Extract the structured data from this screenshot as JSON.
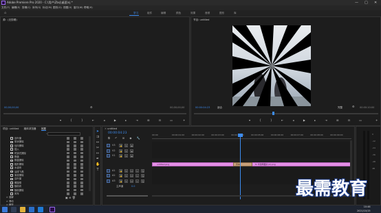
{
  "window": {
    "title": "Adobe Premiere Pro 2020 - C:\\用户\\Zbsj\\桌面\\nj *",
    "controls": [
      "—",
      "□",
      "✕"
    ]
  },
  "menu": [
    "文件(F)",
    "编辑(E)",
    "剪辑(C)",
    "序列(S)",
    "标记(M)",
    "图形(G)",
    "视图(V)",
    "窗口(W)",
    "帮助(H)"
  ],
  "workspaces": [
    "学习",
    "组件",
    "编辑",
    "颜色",
    "效果",
    "音频",
    "图形",
    "库"
  ],
  "workspace_active": "学习",
  "source_panel": {
    "tab": "源：(无剪辑)",
    "timecode_left": "00;00;00;00",
    "timecode_right": "00;00;00;00"
  },
  "program_panel": {
    "tab": "节目: untitled",
    "timecode": "00:00:04:23",
    "fit": "适合",
    "quality": "完整",
    "duration": "00:00:10:00"
  },
  "project_panel": {
    "tabs": [
      "项目: untitled",
      "媒体浏览器",
      "效果"
    ],
    "search_placeholder": "",
    "effects": [
      "百叶窗",
      "带状擦除",
      "径向擦除",
      "插入",
      "时钟式擦除",
      "棋盘",
      "棋盘擦除",
      "楔形擦除",
      "水波块",
      "油漆飞溅",
      "渐变擦除",
      "百叶窗",
      "螺旋框",
      "随机块",
      "随机擦除",
      "风车"
    ],
    "folders": [
      "> 溶解",
      "> 滑动",
      "> 缩放",
      "> 页面剥落"
    ],
    "footer_icons": [
      "list-view-icon",
      "icon-view-icon",
      "freeform-icon",
      "sort-icon",
      "search-icon",
      "folder-icon",
      "new-item-icon",
      "clear-icon"
    ]
  },
  "timeline": {
    "tab": "untitled",
    "timecode": "00:00:04:23",
    "ruler": [
      "00:00",
      "00:00:01:00",
      "00:00:02:00",
      "00:00:03:00",
      "00:00:04:00",
      "00:00:05:00",
      "00:00:06:00",
      "00:00:07:00",
      "00:00:08:00",
      "00:00:09:00"
    ],
    "video_tracks": [
      "V3",
      "V2",
      "V1"
    ],
    "audio_tracks": [
      "A1",
      "A2",
      "A3"
    ],
    "master": "主声道",
    "master_value": "0.0",
    "clip1": "untitled.png",
    "transition": "风车",
    "clip2": "fx 半透明图片(2).png"
  },
  "watermark": "最需教育",
  "taskbar": {
    "time": "10:46",
    "date": "2021/10/15"
  },
  "colors": {
    "accent": "#3d8cf0",
    "clip": "#e48fe6",
    "transition": "#c8a07a"
  }
}
